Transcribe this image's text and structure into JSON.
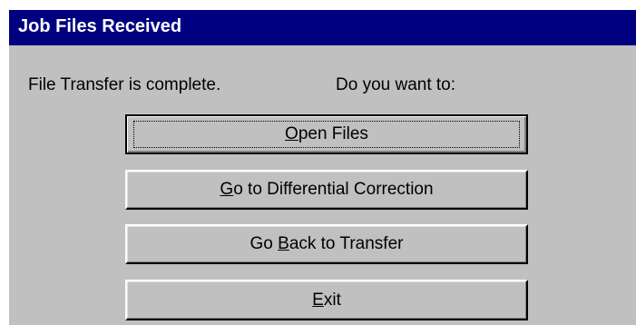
{
  "window": {
    "title": "Job Files Received"
  },
  "message": {
    "status": "File Transfer is complete.",
    "prompt": "Do you want to:"
  },
  "buttons": {
    "open_files": {
      "accel": "O",
      "rest": "pen Files"
    },
    "diff_correction": {
      "accel": "G",
      "rest": "o to Differential Correction"
    },
    "back_to_transfer": {
      "pre": "Go ",
      "accel": "B",
      "rest": "ack to Transfer"
    },
    "exit": {
      "accel": "E",
      "rest": "xit"
    }
  }
}
